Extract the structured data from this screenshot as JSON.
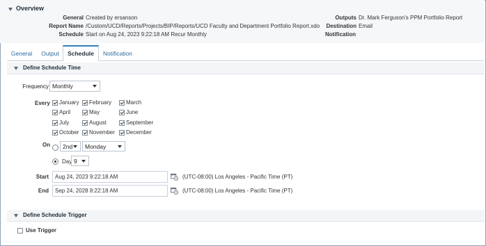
{
  "overview": {
    "title": "Overview",
    "general_label": "General",
    "general_value": "Created by ersanson",
    "report_name_label": "Report Name",
    "report_name_value": "/Custom/UCD/Reports/Projects/BIP/Reports/UCD Faculty and Department Portfolio Report.xdo",
    "schedule_label": "Schedule",
    "schedule_value": "Start on Aug 24, 2023 9:22:18 AM Recur Monthly",
    "outputs_label": "Outputs",
    "outputs_value": "Dr. Mark Ferguson's PPM Portfolio Report",
    "destination_label": "Destination",
    "destination_value": "Email",
    "notification_label": "Notification"
  },
  "tabs": [
    "General",
    "Output",
    "Schedule",
    "Notification"
  ],
  "schedule_time": {
    "section_title": "Define Schedule Time",
    "frequency_label": "Frequency",
    "frequency_value": "Monthly",
    "every_label": "Every",
    "months": [
      "January",
      "February",
      "March",
      "April",
      "May",
      "June",
      "July",
      "August",
      "September",
      "October",
      "November",
      "December"
    ],
    "on_label": "On",
    "on_week": "2nd",
    "on_day": "Monday",
    "day_label": "Day",
    "day_value": "9",
    "start_label": "Start",
    "start_value": "Aug 24, 2023 9:22:18 AM",
    "start_tz": "(UTC-08:00) Los Angeles - Pacific Time (PT)",
    "end_label": "End",
    "end_value": "Sep 24, 2028 8:22:18 AM",
    "end_tz": "(UTC-08:00) Los Angeles - Pacific Time (PT)"
  },
  "schedule_trigger": {
    "section_title": "Define Schedule Trigger",
    "use_trigger_label": "Use Trigger"
  },
  "colors": {
    "link": "#2a6a9e",
    "accent": "#2f7fbf",
    "border": "#8fa3b8"
  }
}
